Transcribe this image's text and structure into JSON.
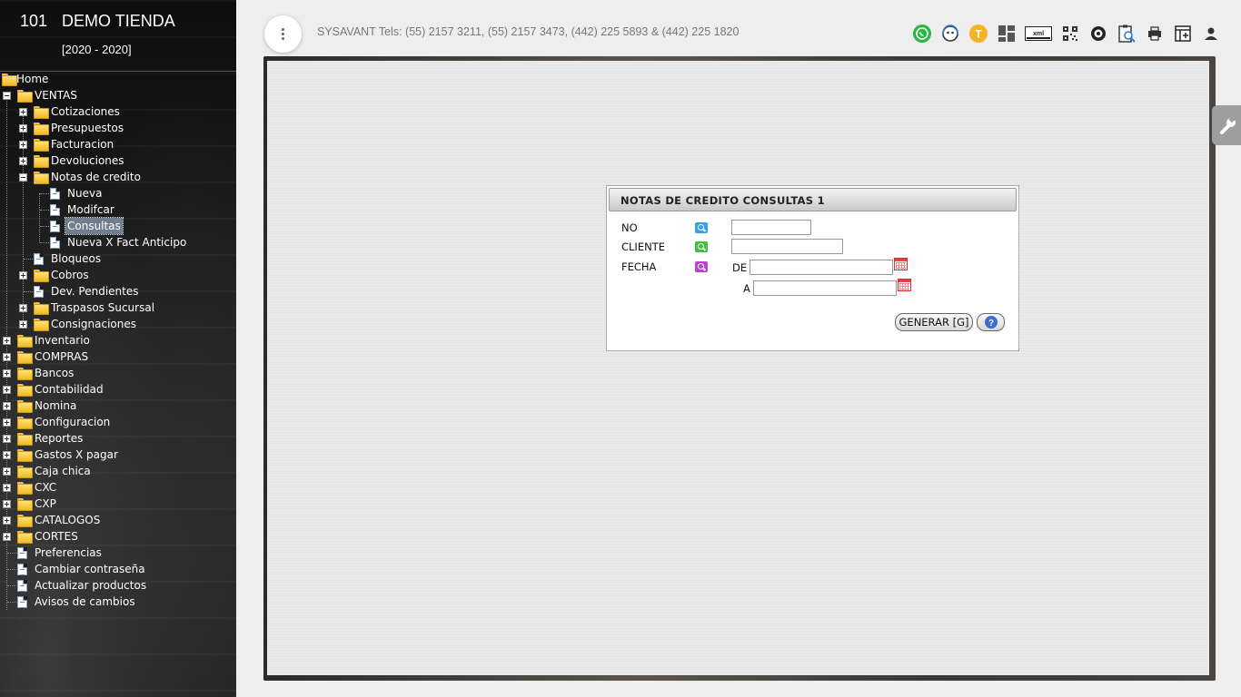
{
  "app": {
    "store_code": "101",
    "store_name": "DEMO TIENDA",
    "years": "[2020 - 2020]",
    "header_text": "SYSAVANT Tels: (55) 2157 3211, (55) 2157 3473, (442) 225 5893 & (442) 225 1820"
  },
  "toolbar_icons": [
    "whatsapp-icon",
    "support-chat-icon",
    "t-badge-icon",
    "dashboard-icon",
    "xml-icon",
    "qr-code-icon",
    "tire-icon",
    "clipboard-search-icon",
    "printer-icon",
    "layout-add-icon",
    "user-icon"
  ],
  "tree": {
    "home": "Home",
    "ventas": "VENTAS",
    "cotizaciones": "Cotizaciones",
    "presupuestos": "Presupuestos",
    "facturacion": "Facturacion",
    "devoluciones": "Devoluciones",
    "notas_credito": "Notas de credito",
    "nueva": "Nueva",
    "modificar": "Modifcar",
    "consultas": "Consultas",
    "nueva_anticipo": "Nueva X Fact Anticipo",
    "bloqueos": "Bloqueos",
    "cobros": "Cobros",
    "dev_pendientes": "Dev. Pendientes",
    "traspasos": "Traspasos Sucursal",
    "consignaciones": "Consignaciones",
    "inventario": "Inventario",
    "compras": "COMPRAS",
    "bancos": "Bancos",
    "contabilidad": "Contabilidad",
    "nomina": "Nomina",
    "configuracion": "Configuracion",
    "reportes": "Reportes",
    "gastos": "Gastos X pagar",
    "caja": "Caja chica",
    "cxc": "CXC",
    "cxp": "CXP",
    "catalogos": "CATALOGOS",
    "cortes": "CORTES",
    "preferencias": "Preferencias",
    "cambiar_pw": "Cambiar contraseña",
    "actualizar": "Actualizar productos",
    "avisos": "Avisos de cambios"
  },
  "panel": {
    "title": "NOTAS DE CREDITO CONSULTAS 1",
    "label_no": "NO",
    "label_cliente": "CLIENTE",
    "label_fecha": "FECHA",
    "label_de": "DE",
    "label_a": "A",
    "no_value": "",
    "cliente_value": "",
    "fecha_de_value": "",
    "fecha_a_value": "",
    "generar_label": "GENERAR [G]",
    "help_label": "?"
  },
  "colors": {
    "mag_no": "#3aa0e8",
    "mag_cliente": "#3ec23e",
    "mag_fecha": "#c23ed8"
  }
}
